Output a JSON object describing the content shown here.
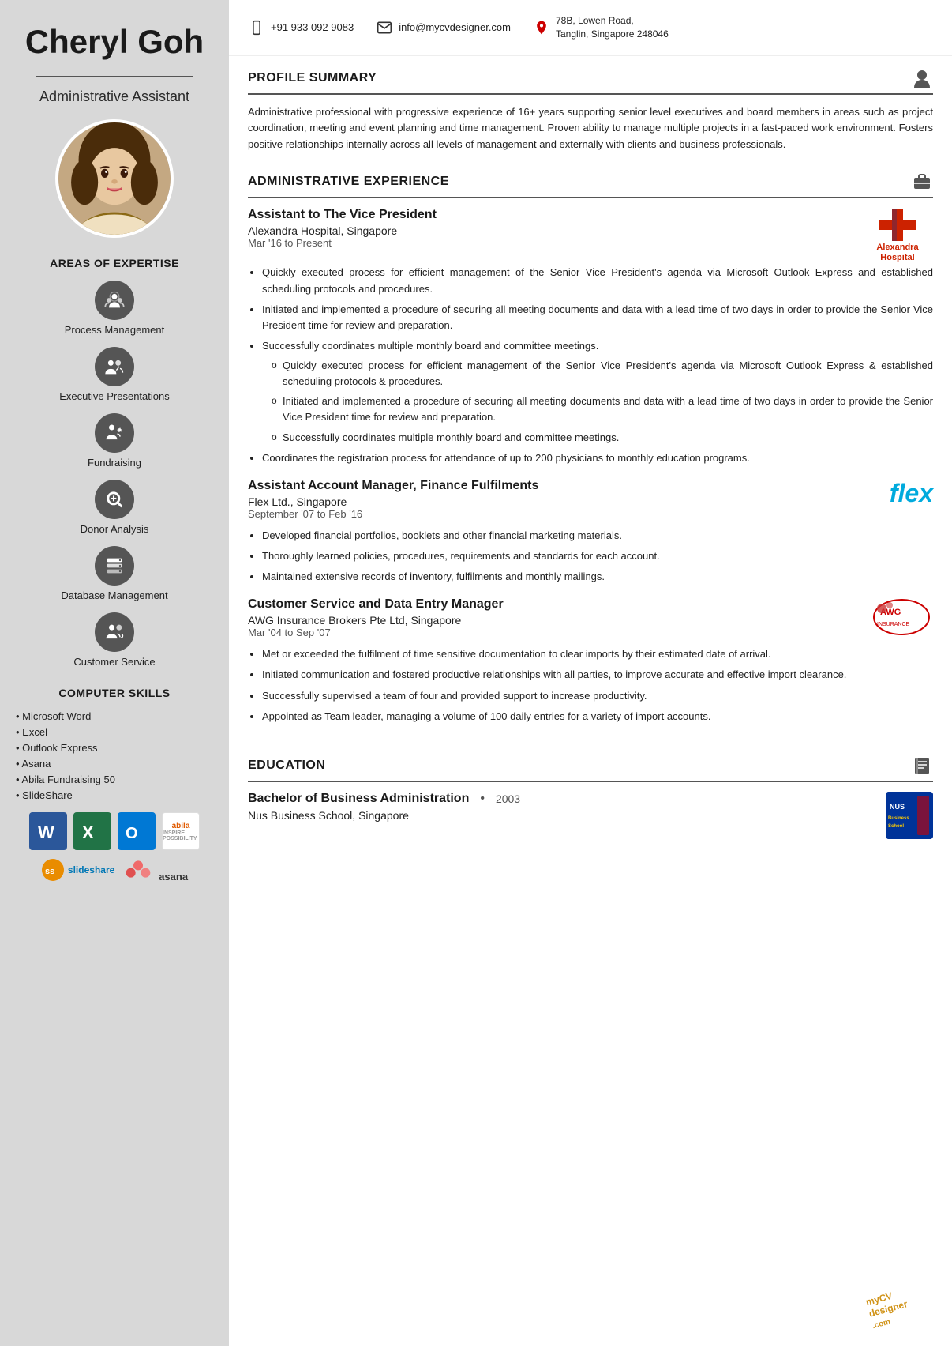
{
  "sidebar": {
    "name": "Cheryl Goh",
    "job_title": "Administrative Assistant",
    "areas_of_expertise_label": "AREAS OF EXPERTISE",
    "expertise_items": [
      {
        "id": "process-mgmt",
        "label": "Process Management"
      },
      {
        "id": "exec-presentations",
        "label": "Executive Presentations"
      },
      {
        "id": "fundraising",
        "label": "Fundraising"
      },
      {
        "id": "donor-analysis",
        "label": "Donor Analysis"
      },
      {
        "id": "database-mgmt",
        "label": "Database Management"
      },
      {
        "id": "customer-service",
        "label": "Customer Service"
      }
    ],
    "computer_skills_label": "COMPUTER SKILLS",
    "skills_list": [
      "Microsoft Word",
      "Excel",
      "Outlook Express",
      "Asana",
      "Abila Fundraising 50",
      "SlideShare"
    ]
  },
  "contact": {
    "phone": "+91 933 092 9083",
    "email": "info@mycvdesigner.com",
    "address_line1": "78B, Lowen Road,",
    "address_line2": "Tanglin, Singapore 248046"
  },
  "profile_summary": {
    "section_label": "PROFILE SUMMARY",
    "text": "Administrative professional with progressive experience of 16+ years supporting senior level executives and board members in areas such as project coordination, meeting and event planning and time management. Proven ability to manage multiple projects in a fast-paced work environment. Fosters positive relationships internally across all levels of management and externally with clients and business professionals."
  },
  "admin_experience": {
    "section_label": "ADMINISTRATIVE EXPERIENCE",
    "jobs": [
      {
        "id": "job1",
        "title": "Assistant to The Vice President",
        "company": "Alexandra Hospital, Singapore",
        "dates": "Mar '16 to Present",
        "logo": "alexandra",
        "bullets": [
          "Quickly executed process for efficient management of the Senior Vice President's agenda via Microsoft Outlook Express and established scheduling protocols and procedures.",
          "Initiated and implemented a procedure of securing all meeting documents and data with a lead time of two days in order to provide the Senior Vice President time for review and preparation.",
          "Successfully coordinates multiple monthly board and committee meetings."
        ],
        "sub_bullets": [
          "Quickly executed process for efficient management of the Senior Vice President's agenda via Microsoft Outlook Express & established scheduling protocols & procedures.",
          "Initiated and implemented a procedure of securing all meeting documents and data with a lead time of two days in order to provide the Senior Vice President time for review and preparation.",
          "Successfully coordinates multiple monthly board and committee meetings."
        ],
        "extra_bullet": "Coordinates the registration process for attendance of up to 200 physicians to monthly education programs."
      },
      {
        "id": "job2",
        "title": "Assistant Account Manager, Finance Fulfilments",
        "company": "Flex Ltd., Singapore",
        "dates": "September '07 to Feb '16",
        "logo": "flex",
        "bullets": [
          "Developed financial portfolios, booklets and other financial marketing materials.",
          "Thoroughly learned policies, procedures, requirements and standards for each account.",
          "Maintained extensive records of inventory, fulfilments and monthly mailings."
        ]
      },
      {
        "id": "job3",
        "title": "Customer Service and Data Entry Manager",
        "company": "AWG Insurance Brokers Pte Ltd, Singapore",
        "dates": "Mar '04 to Sep '07",
        "logo": "awg",
        "bullets": [
          "Met or exceeded the fulfilment of time sensitive documentation to clear imports by their estimated date of arrival.",
          "Initiated communication and fostered productive relationships with all parties, to improve accurate and effective import clearance.",
          "Successfully supervised a team of four and provided support to increase productivity.",
          "Appointed as Team leader, managing a volume of 100 daily entries for a variety of import accounts."
        ]
      }
    ]
  },
  "education": {
    "section_label": "EDUCATION",
    "degree": "Bachelor of Business Administration",
    "year": "2003",
    "school": "Nus Business School, Singapore"
  }
}
